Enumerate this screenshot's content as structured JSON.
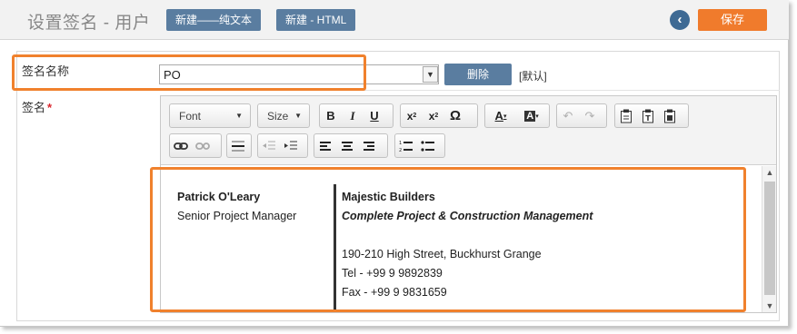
{
  "header": {
    "title": "设置签名 - 用户",
    "new_plain_label": "新建——纯文本",
    "new_html_label": "新建 - HTML",
    "back_icon": "back-arrow-icon",
    "save_label": "保存"
  },
  "form": {
    "name_label": "签名名称",
    "name_value": "PO",
    "delete_label": "删除",
    "default_label": "[默认]",
    "signature_label": "签名",
    "required_mark": "*"
  },
  "toolbar": {
    "font_label": "Font",
    "size_label": "Size"
  },
  "signature": {
    "name": "Patrick O'Leary",
    "role": "Senior Project Manager",
    "company": "Majestic Builders",
    "tagline": "Complete Project & Construction Management",
    "address": "190-210 High Street, Buckhurst Grange",
    "tel": "Tel - +99 9 9892839",
    "fax": "Fax - +99 9 9831659"
  },
  "colors": {
    "accent_orange": "#f07b2c",
    "button_blue": "#5a7da0",
    "highlight": "#f0812d"
  }
}
